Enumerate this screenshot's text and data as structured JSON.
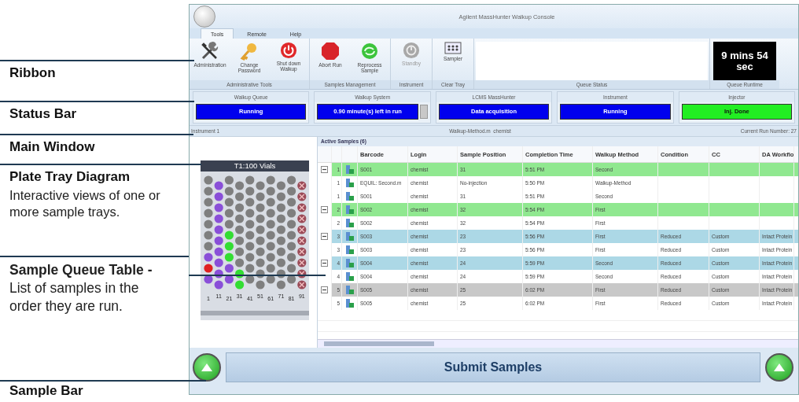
{
  "callouts": [
    {
      "title": "Ribbon"
    },
    {
      "title": "Status Bar"
    },
    {
      "title": "Main Window"
    },
    {
      "title": "Plate Tray Diagram",
      "description": "Interactive views of one or more sample trays."
    },
    {
      "text": "**Sample Queue Table -** List of samples in the order they are run."
    },
    {
      "title": "Sample Bar"
    }
  ],
  "window": {
    "title": "Agilent MassHunter Walkup Console"
  },
  "tabs": [
    {
      "label": "Tools",
      "selected": true
    },
    {
      "label": "Remote",
      "selected": false
    },
    {
      "label": "Help",
      "selected": false
    }
  ],
  "ribbon": {
    "groups": [
      {
        "label": "Administrative Tools",
        "buttons": [
          {
            "label": "Administration",
            "disabled": false
          },
          {
            "label": "Change Password",
            "disabled": false
          },
          {
            "label": "Shut down Walkup",
            "disabled": false
          }
        ]
      },
      {
        "label": "Samples Management",
        "buttons": [
          {
            "label": "Abort Run",
            "disabled": false
          },
          {
            "label": "Reprocess Sample",
            "disabled": false
          }
        ]
      },
      {
        "label": "Instrument",
        "buttons": [
          {
            "label": "Standby",
            "disabled": true
          }
        ]
      },
      {
        "label": "Clear Tray",
        "buttons": [
          {
            "label": "Sampler",
            "disabled": false
          }
        ]
      }
    ],
    "queue_status": {
      "label": "Queue Status"
    },
    "queue_runtime": {
      "label": "Queue Runtime",
      "value": "9 mins 54 sec"
    }
  },
  "status_bar": [
    {
      "title": "Walkup Queue",
      "value": "Running",
      "color": "#0000ee"
    },
    {
      "title": "Walkup System",
      "value": "0.90 minute(s) left in run",
      "color": "#0000ee"
    },
    {
      "title": "LCMS MassHunter",
      "value": "Data acquisition",
      "color": "#0000ee"
    },
    {
      "title": "Instrument",
      "value": "Running",
      "color": "#0000ee"
    },
    {
      "title": "Injector",
      "value": "Inj. Done",
      "color": "#22ee22"
    }
  ],
  "info_bar": {
    "instrument": "Instrument 1",
    "method": "Walkup-Method.m  chemist",
    "run_number": "Current Run Number: 27"
  },
  "tray": {
    "title": "T1:100 Vials",
    "columns": [
      {
        "label": "1",
        "marked": false,
        "vials": [
          {
            "color": "#7f7f7f"
          },
          {
            "color": "#7f7f7f"
          },
          {
            "color": "#7f7f7f"
          },
          {
            "color": "#7f7f7f"
          },
          {
            "color": "#7f7f7f"
          },
          {
            "color": "#7f7f7f"
          },
          {
            "color": "#7f7f7f"
          },
          {
            "color": "#8a4fd8"
          },
          {
            "color": "#e02020"
          },
          {
            "color": "#8a4fd8"
          }
        ]
      },
      {
        "label": "11",
        "marked": false,
        "vials": [
          {
            "color": "#8a4fd8"
          },
          {
            "color": "#8a4fd8"
          },
          {
            "color": "#8a4fd8"
          },
          {
            "color": "#8a4fd8"
          },
          {
            "color": "#8a4fd8"
          },
          {
            "color": "#8a4fd8"
          },
          {
            "color": "#8a4fd8"
          },
          {
            "color": "#8a4fd8"
          },
          {
            "color": "#8a4fd8"
          },
          {
            "color": "#8a4fd8"
          }
        ]
      },
      {
        "label": "21",
        "marked": false,
        "vials": [
          {
            "color": "#7f7f7f"
          },
          {
            "color": "#7f7f7f"
          },
          {
            "color": "#7f7f7f"
          },
          {
            "color": "#7f7f7f"
          },
          {
            "color": "#7f7f7f"
          },
          {
            "color": "#33dd33"
          },
          {
            "color": "#33dd33"
          },
          {
            "color": "#33dd33"
          },
          {
            "color": "#8a4fd8"
          },
          {
            "color": "#8a4fd8"
          }
        ]
      },
      {
        "label": "31",
        "marked": false,
        "vials": [
          {
            "color": "#7f7f7f"
          },
          {
            "color": "#7f7f7f"
          },
          {
            "color": "#7f7f7f"
          },
          {
            "color": "#7f7f7f"
          },
          {
            "color": "#7f7f7f"
          },
          {
            "color": "#7f7f7f"
          },
          {
            "color": "#7f7f7f"
          },
          {
            "color": "#7f7f7f"
          },
          {
            "color": "#33dd33"
          },
          {
            "color": "#33dd33"
          }
        ]
      },
      {
        "label": "41",
        "marked": false,
        "vials": [
          {
            "color": "#7f7f7f"
          },
          {
            "color": "#7f7f7f"
          },
          {
            "color": "#7f7f7f"
          },
          {
            "color": "#7f7f7f"
          },
          {
            "color": "#7f7f7f"
          },
          {
            "color": "#7f7f7f"
          },
          {
            "color": "#7f7f7f"
          },
          {
            "color": "#7f7f7f"
          },
          {
            "color": "#7f7f7f"
          },
          {
            "color": "#7f7f7f"
          }
        ]
      },
      {
        "label": "51",
        "marked": false,
        "vials": [
          {
            "color": "#7f7f7f"
          },
          {
            "color": "#7f7f7f"
          },
          {
            "color": "#7f7f7f"
          },
          {
            "color": "#7f7f7f"
          },
          {
            "color": "#7f7f7f"
          },
          {
            "color": "#7f7f7f"
          },
          {
            "color": "#7f7f7f"
          },
          {
            "color": "#7f7f7f"
          },
          {
            "color": "#7f7f7f"
          },
          {
            "color": "#7f7f7f"
          }
        ]
      },
      {
        "label": "61",
        "marked": false,
        "vials": [
          {
            "color": "#7f7f7f"
          },
          {
            "color": "#7f7f7f"
          },
          {
            "color": "#7f7f7f"
          },
          {
            "color": "#7f7f7f"
          },
          {
            "color": "#7f7f7f"
          },
          {
            "color": "#7f7f7f"
          },
          {
            "color": "#7f7f7f"
          },
          {
            "color": "#7f7f7f"
          },
          {
            "color": "#7f7f7f"
          },
          {
            "color": "#7f7f7f"
          }
        ]
      },
      {
        "label": "71",
        "marked": false,
        "vials": [
          {
            "color": "#7f7f7f"
          },
          {
            "color": "#7f7f7f"
          },
          {
            "color": "#7f7f7f"
          },
          {
            "color": "#7f7f7f"
          },
          {
            "color": "#7f7f7f"
          },
          {
            "color": "#7f7f7f"
          },
          {
            "color": "#7f7f7f"
          },
          {
            "color": "#7f7f7f"
          },
          {
            "color": "#7f7f7f"
          },
          {
            "color": "#7f7f7f"
          }
        ]
      },
      {
        "label": "81",
        "marked": false,
        "vials": [
          {
            "color": "#7f7f7f"
          },
          {
            "color": "#7f7f7f"
          },
          {
            "color": "#7f7f7f"
          },
          {
            "color": "#7f7f7f"
          },
          {
            "color": "#7f7f7f"
          },
          {
            "color": "#7f7f7f"
          },
          {
            "color": "#7f7f7f"
          },
          {
            "color": "#7f7f7f"
          },
          {
            "color": "#7f7f7f"
          },
          {
            "color": "#7f7f7f"
          }
        ]
      },
      {
        "label": "91",
        "marked": true,
        "vials": [
          {
            "color": "#9b4b58"
          },
          {
            "color": "#9b4b58"
          },
          {
            "color": "#9b4b58"
          },
          {
            "color": "#9b4b58"
          },
          {
            "color": "#9b4b58"
          },
          {
            "color": "#9b4b58"
          },
          {
            "color": "#9b4b58"
          },
          {
            "color": "#9b4b58"
          },
          {
            "color": "#9b4b58"
          },
          {
            "color": "#9b4b58"
          }
        ]
      }
    ]
  },
  "table": {
    "title": "Active Samples (6)",
    "columns": [
      "Barcode",
      "Login",
      "Sample Position",
      "Completion Time",
      "Walkup Method",
      "Condition",
      "CC",
      "DA Workflo"
    ],
    "rows": [
      {
        "kind": "parent",
        "expanded": true,
        "color": "#90e890",
        "number": "1",
        "cells": [
          "S001",
          "chemist",
          "31",
          "5:51 PM",
          "Second",
          "",
          "",
          ""
        ]
      },
      {
        "kind": "child",
        "number": "1",
        "cells": [
          "EQUIL: Second.m",
          "chemist",
          "No-injection",
          "5:50 PM",
          "Walkup-Method",
          "",
          "",
          ""
        ]
      },
      {
        "kind": "child",
        "number": "1",
        "cells": [
          "S001",
          "chemist",
          "31",
          "5:51 PM",
          "Second",
          "",
          "",
          ""
        ]
      },
      {
        "kind": "parent",
        "expanded": true,
        "color": "#90e890",
        "number": "2",
        "cells": [
          "S002",
          "chemist",
          "32",
          "5:54 PM",
          "First",
          "",
          "",
          ""
        ]
      },
      {
        "kind": "child",
        "number": "2",
        "cells": [
          "S002",
          "chemist",
          "32",
          "5:54 PM",
          "First",
          "",
          "",
          ""
        ]
      },
      {
        "kind": "parent",
        "expanded": true,
        "color": "#acd8e6",
        "number": "3",
        "cells": [
          "S003",
          "chemist",
          "23",
          "5:56 PM",
          "First",
          "Reduced",
          "Custom",
          "Intact Protein"
        ]
      },
      {
        "kind": "child",
        "number": "3",
        "cells": [
          "S003",
          "chemist",
          "23",
          "5:56 PM",
          "First",
          "Reduced",
          "Custom",
          "Intact Protein"
        ]
      },
      {
        "kind": "parent",
        "expanded": true,
        "color": "#acd8e6",
        "number": "4",
        "cells": [
          "S004",
          "chemist",
          "24",
          "5:59 PM",
          "Second",
          "Reduced",
          "Custom",
          "Intact Protein"
        ]
      },
      {
        "kind": "child",
        "number": "4",
        "cells": [
          "S004",
          "chemist",
          "24",
          "5:59 PM",
          "Second",
          "Reduced",
          "Custom",
          "Intact Protein"
        ]
      },
      {
        "kind": "parent",
        "expanded": true,
        "color": "#c8c8c8",
        "number": "5",
        "cells": [
          "S005",
          "chemist",
          "25",
          "6:02 PM",
          "First",
          "Reduced",
          "Custom",
          "Intact Protein"
        ]
      },
      {
        "kind": "child",
        "number": "5",
        "cells": [
          "S005",
          "chemist",
          "25",
          "6:02 PM",
          "First",
          "Reduced",
          "Custom",
          "Intact Protein"
        ]
      }
    ]
  },
  "sample_bar": {
    "submit": "Submit Samples"
  }
}
